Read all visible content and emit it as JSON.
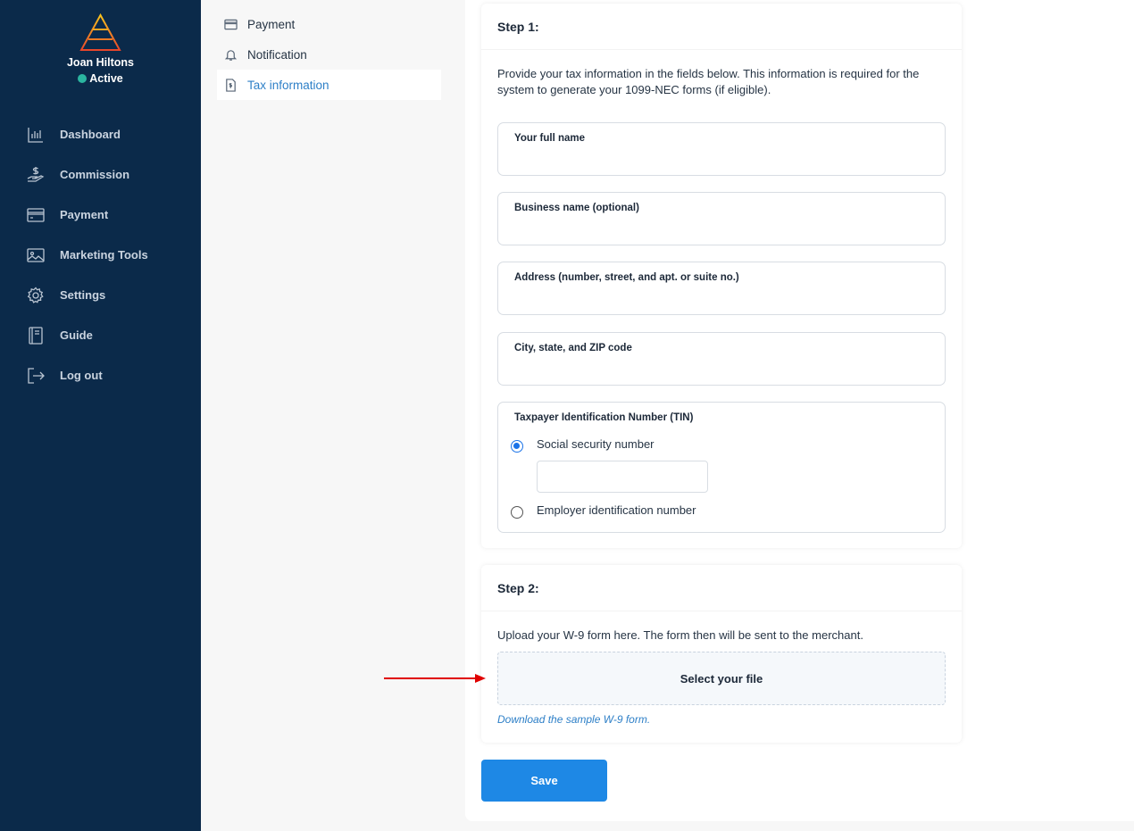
{
  "user": {
    "name": "Joan Hiltons",
    "status": "Active"
  },
  "nav": [
    {
      "label": "Dashboard",
      "icon": "bar-chart-icon"
    },
    {
      "label": "Commission",
      "icon": "hand-dollar-icon"
    },
    {
      "label": "Payment",
      "icon": "credit-card-icon"
    },
    {
      "label": "Marketing Tools",
      "icon": "image-icon"
    },
    {
      "label": "Settings",
      "icon": "gear-icon"
    },
    {
      "label": "Guide",
      "icon": "book-icon"
    },
    {
      "label": "Log out",
      "icon": "logout-icon"
    }
  ],
  "submenu": [
    {
      "label": "Payment",
      "icon": "credit-card-icon"
    },
    {
      "label": "Notification",
      "icon": "bell-icon"
    },
    {
      "label": "Tax information",
      "icon": "tax-document-icon",
      "active": true
    }
  ],
  "step1": {
    "title": "Step 1:",
    "intro": "Provide your tax information in the fields below. This information is required for the system to generate your 1099-NEC forms (if eligible).",
    "fields": {
      "full_name": {
        "label": "Your full name",
        "value": ""
      },
      "business_name": {
        "label": "Business name (optional)",
        "value": ""
      },
      "address": {
        "label": "Address (number, street, and apt. or suite no.)",
        "value": ""
      },
      "city": {
        "label": "City, state, and ZIP code",
        "value": ""
      }
    },
    "tin": {
      "label": "Taxpayer Identification Number (TIN)",
      "options": [
        {
          "label": "Social security number",
          "selected": true
        },
        {
          "label": "Employer identification number",
          "selected": false
        }
      ],
      "ssn_value": ""
    }
  },
  "step2": {
    "title": "Step 2:",
    "instructions": "Upload your W-9 form here. The form then will be sent to the merchant.",
    "select_file": "Select your file",
    "download_link": "Download the sample W-9 form."
  },
  "save_label": "Save",
  "colors": {
    "sidebar": "#0b2a4a",
    "accent": "#1e88e5",
    "link": "#2d7fc7",
    "status": "#2bb5a0",
    "annotation_arrow": "#e00000"
  }
}
